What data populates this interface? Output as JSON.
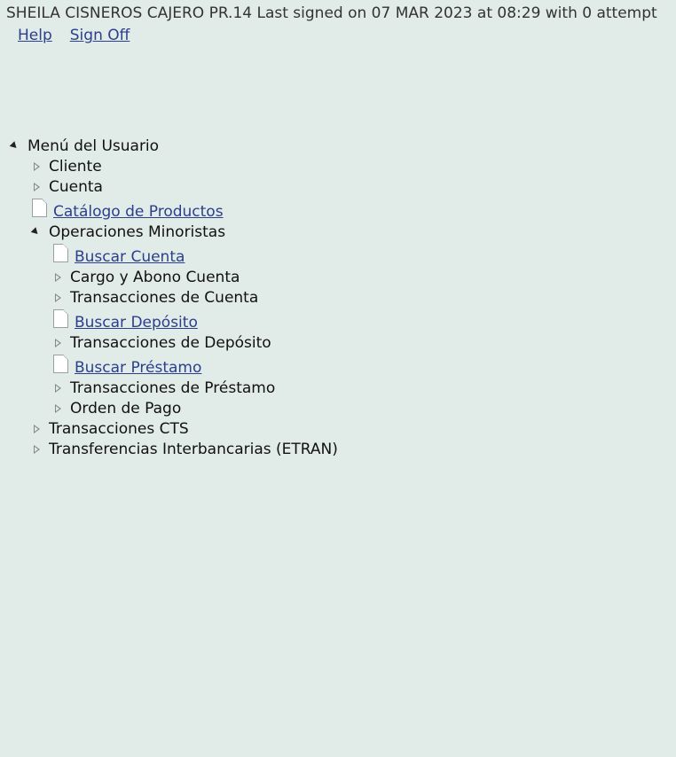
{
  "header": {
    "signon_text": "SHEILA CISNEROS CAJERO PR.14 Last signed on 07 MAR 2023 at 08:29 with 0 attempt",
    "help_label": "Help",
    "signoff_label": "Sign Off"
  },
  "tree": {
    "root": {
      "label": "Menú del Usuario"
    },
    "items": [
      {
        "label": "Cliente"
      },
      {
        "label": "Cuenta"
      },
      {
        "label": "Catálogo de Productos"
      },
      {
        "label": "Operaciones Minoristas"
      },
      {
        "label": "Buscar Cuenta"
      },
      {
        "label": "Cargo y Abono Cuenta"
      },
      {
        "label": "Transacciones de Cuenta"
      },
      {
        "label": "Buscar Depósito"
      },
      {
        "label": "Transacciones de Depósito"
      },
      {
        "label": "Buscar Préstamo"
      },
      {
        "label": "Transacciones de Préstamo"
      },
      {
        "label": "Orden de Pago"
      },
      {
        "label": "Transacciones CTS"
      },
      {
        "label": "Transferencias Interbancarias (ETRAN)"
      }
    ]
  }
}
